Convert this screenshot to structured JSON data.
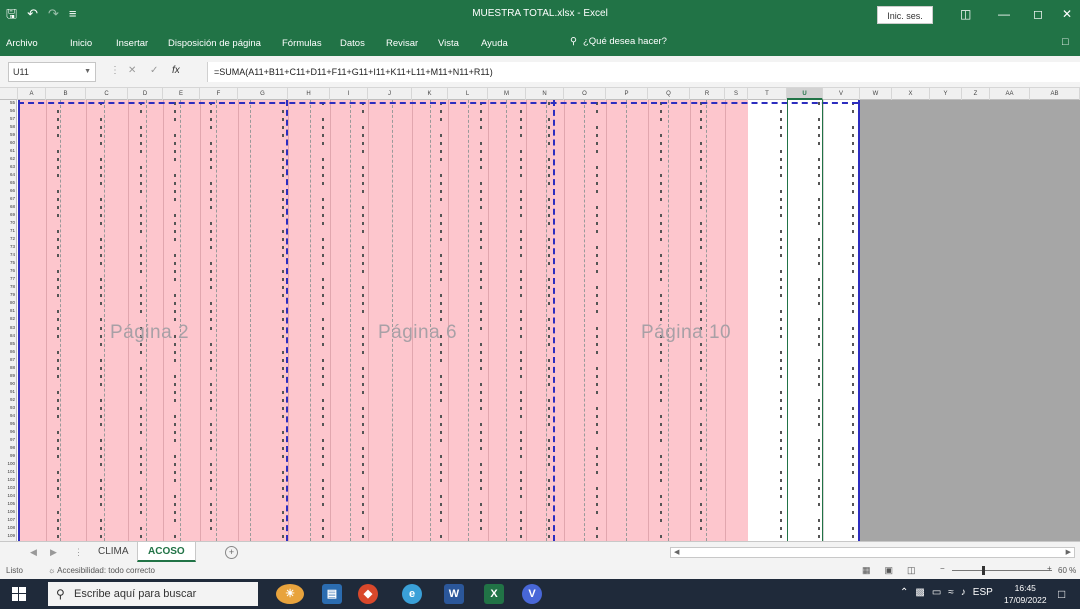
{
  "titlebar": {
    "title": "MUESTRA TOTAL.xlsx - Excel",
    "signin_label": "Inic. ses.",
    "qat": [
      "save-icon",
      "undo-icon",
      "redo-icon",
      "customize-icon"
    ]
  },
  "ribbon": {
    "tabs": [
      "Archivo",
      "Inicio",
      "Insertar",
      "Disposición de página",
      "Fórmulas",
      "Datos",
      "Revisar",
      "Vista",
      "Ayuda"
    ],
    "tellme": "¿Qué desea hacer?"
  },
  "formula_bar": {
    "name_box": "U11",
    "fx": "fx",
    "formula": "=SUMA(A11+B11+C11+D11+F11+G11+I11+K11+L11+M11+N11+R11)"
  },
  "columns": [
    "A",
    "B",
    "C",
    "D",
    "E",
    "F",
    "G",
    "H",
    "I",
    "J",
    "K",
    "L",
    "M",
    "N",
    "O",
    "P",
    "Q",
    "R",
    "S",
    "T",
    "U",
    "V",
    "W",
    "X",
    "Y",
    "Z",
    "AA",
    "AB"
  ],
  "selected_column": "U",
  "rows": {
    "first": 55,
    "last": 109
  },
  "page_labels": [
    "Página 2",
    "Página 6",
    "Página 10"
  ],
  "sheet_tabs": [
    {
      "name": "CLIMA",
      "active": false
    },
    {
      "name": "ACOSO",
      "active": true
    }
  ],
  "status": {
    "ready": "Listo",
    "accessibility": "Accesibilidad: todo correcto",
    "zoom": "60 %"
  },
  "taskbar": {
    "search_placeholder": "Escribe aquí para buscar",
    "language": "ESP",
    "time": "16:45",
    "date": "17/09/2022"
  },
  "colors": {
    "excel_green": "#217346",
    "print_area_pink": "#fdc6cd",
    "page_break_blue": "#2d2dbf",
    "outside_gray": "#a6a6a6"
  }
}
